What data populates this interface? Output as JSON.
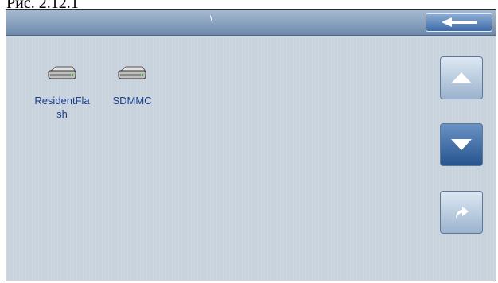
{
  "caption": "Рис. 2.12.1",
  "titlebar": {
    "path": "\\"
  },
  "drives": [
    {
      "label": "ResidentFlash",
      "icon": "drive-icon"
    },
    {
      "label": "SDMMC",
      "icon": "drive-icon"
    }
  ],
  "buttons": {
    "back": {
      "icon": "arrow-left-icon"
    },
    "scroll_up": {
      "icon": "triangle-up-icon"
    },
    "scroll_down": {
      "icon": "triangle-down-icon"
    },
    "open": {
      "icon": "curved-arrow-right-icon"
    }
  },
  "colors": {
    "titlebar": "#8ea6c2",
    "background": "#c9d3dd",
    "label_text": "#1a3f8a",
    "active_button": "#3d6aa8"
  }
}
